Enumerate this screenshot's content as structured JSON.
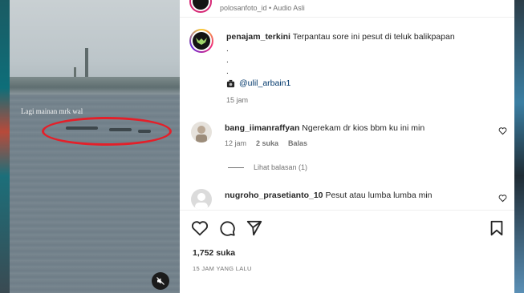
{
  "video": {
    "overlay_caption": "Lagi mainan mrk wal",
    "mute_icon": "speaker-muted-icon"
  },
  "post_header": {
    "meta": "polosanfoto_id • Audio Asli"
  },
  "caption": {
    "username": "penajam_terkini",
    "text": "Terpantau sore ini pesut di teluk balikpapan",
    "dots": [
      ".",
      ".",
      "."
    ],
    "mention": "@ulil_arbain1",
    "time": "15 jam"
  },
  "comments": [
    {
      "username": "bang_iimanraffyan",
      "text": "Ngerekam dr kios bbm ku ini min",
      "time": "12 jam",
      "likes": "2 suka",
      "reply": "Balas",
      "view_replies": "Lihat balasan (1)"
    },
    {
      "username": "nugroho_prasetianto_10",
      "text": "Pesut atau lumba lumba min"
    }
  ],
  "actions": {
    "like_icon": "heart-icon",
    "comment_icon": "comment-icon",
    "share_icon": "send-icon",
    "save_icon": "bookmark-icon"
  },
  "likes": "1,752 suka",
  "posted_ago": "15 JAM YANG LALU",
  "colors": {
    "ellipse": "#e3202a",
    "link": "#00376b",
    "muted_text": "#737373"
  }
}
